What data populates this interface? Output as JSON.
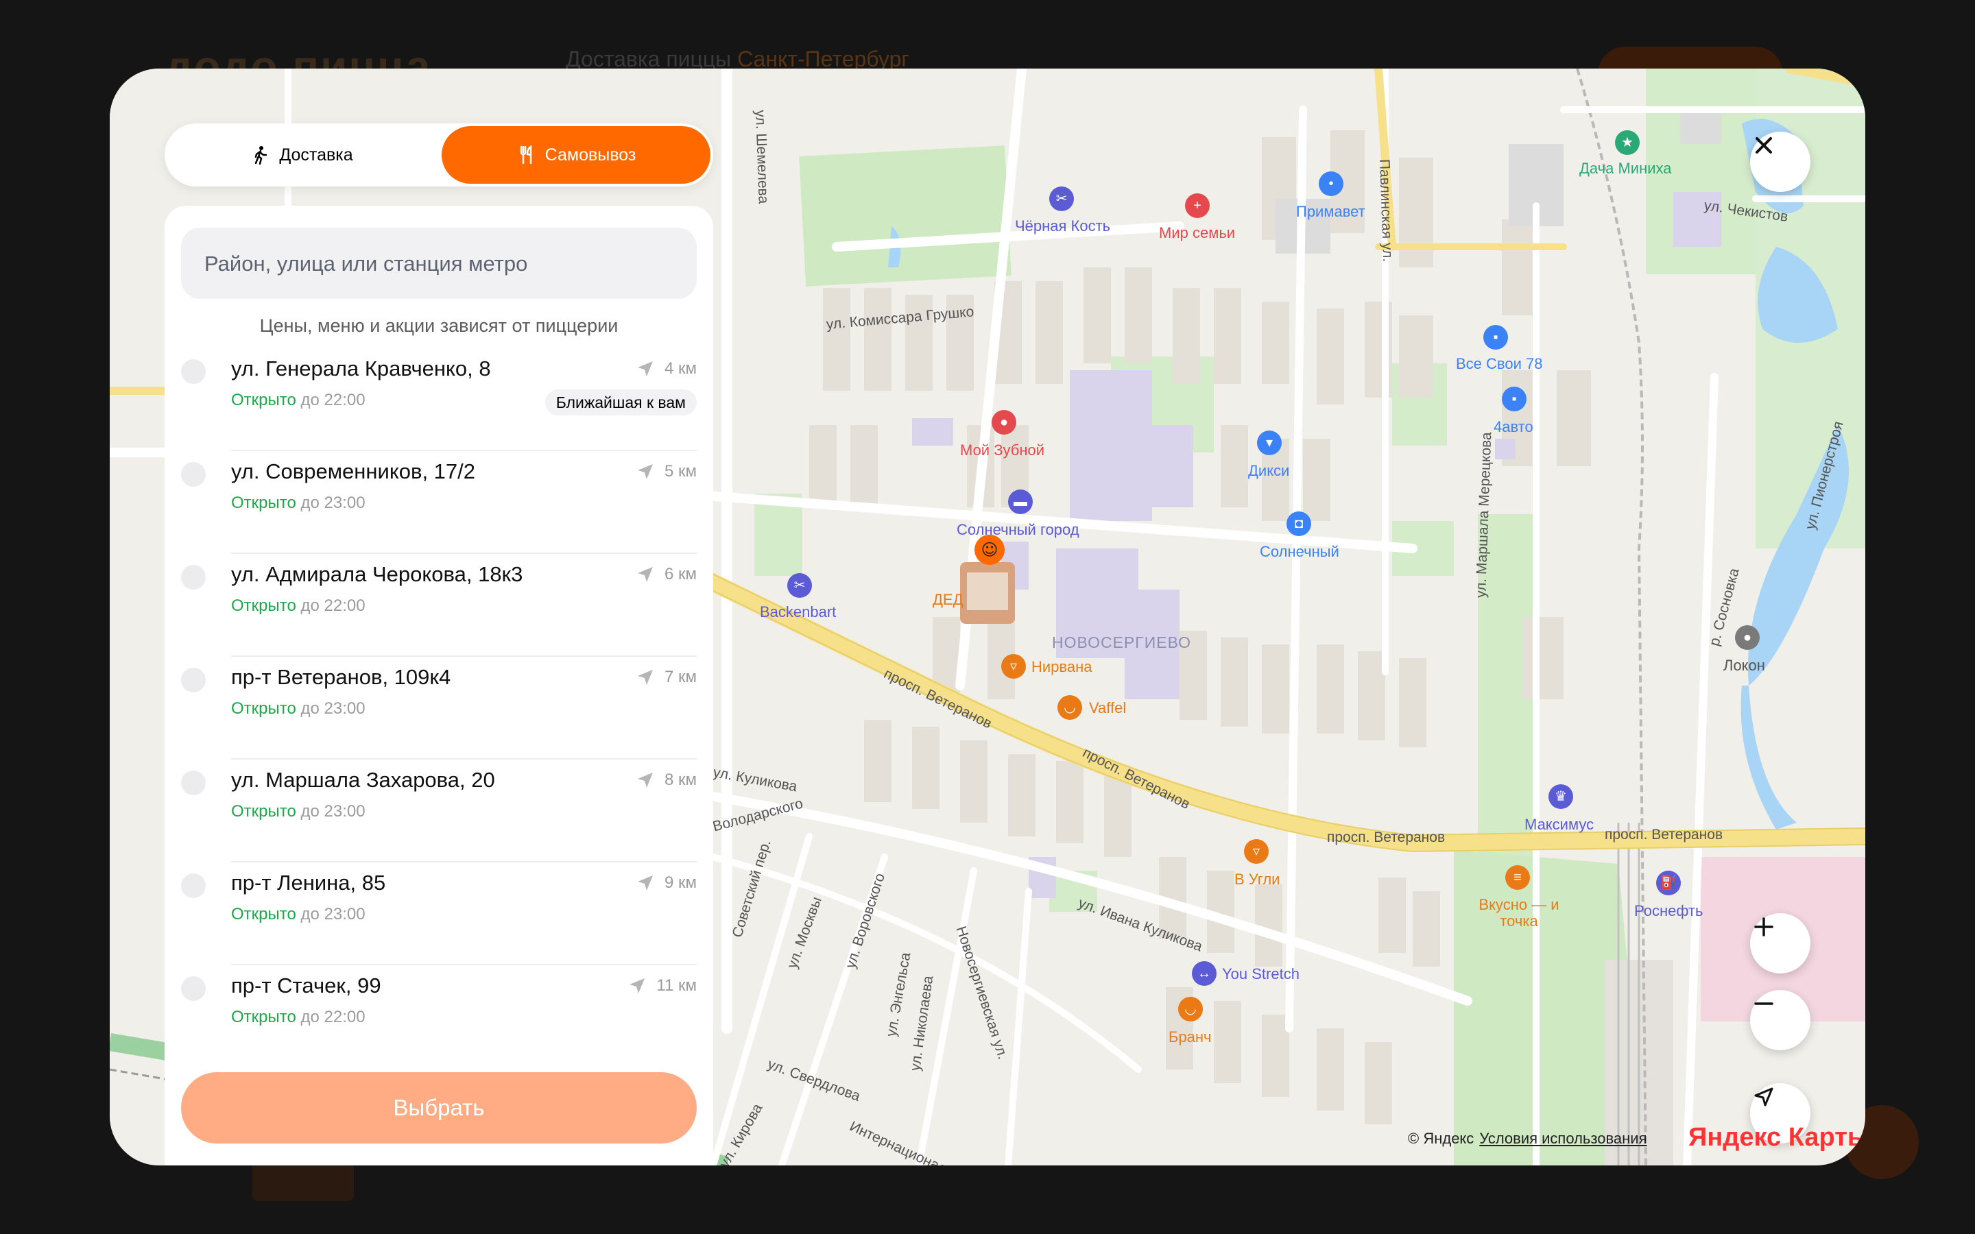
{
  "background": {
    "logo": "додо пицца",
    "delivery_title": "Доставка пиццы",
    "city": "Санкт-Петербург"
  },
  "toggle": {
    "delivery_label": "Доставка",
    "pickup_label": "Самовывоз",
    "active": "pickup"
  },
  "search": {
    "placeholder": "Район, улица или станция метро",
    "value": ""
  },
  "hint": "Цены, меню и акции зависят от пиццерии",
  "pizzerias": [
    {
      "address": "ул. Генерала Кравченко, 8",
      "status": "Открыто",
      "hours": "до 22:00",
      "distance": "4 км",
      "badge": "Ближайшая к вам"
    },
    {
      "address": "ул. Современников, 17/2",
      "status": "Открыто",
      "hours": "до 23:00",
      "distance": "5 км"
    },
    {
      "address": "ул. Адмирала Черокова, 18к3",
      "status": "Открыто",
      "hours": "до 22:00",
      "distance": "6 км"
    },
    {
      "address": "пр-т Ветеранов, 109к4",
      "status": "Открыто",
      "hours": "до 23:00",
      "distance": "7 км"
    },
    {
      "address": "ул. Маршала Захарова, 20",
      "status": "Открыто",
      "hours": "до 23:00",
      "distance": "8 км"
    },
    {
      "address": "пр-т Ленина, 85",
      "status": "Открыто",
      "hours": "до 23:00",
      "distance": "9 км"
    },
    {
      "address": "пр-т Стачек, 99",
      "status": "Открыто",
      "hours": "до 22:00",
      "distance": "11 км"
    }
  ],
  "choose_button": "Выбрать",
  "map": {
    "pois": [
      {
        "name": "Чёрная Кость",
        "color": "#5b5bd6",
        "icon": "scissors-icon"
      },
      {
        "name": "Мир семьи",
        "color": "#e5484d",
        "icon": "medical-icon"
      },
      {
        "name": "Примавет",
        "color": "#3b82f6",
        "icon": "paw-icon"
      },
      {
        "name": "Дача Миниха",
        "color": "#2aa876",
        "icon": "star-icon"
      },
      {
        "name": "Все Свои 78",
        "color": "#3b82f6",
        "icon": "car-icon"
      },
      {
        "name": "4авто",
        "color": "#3b82f6",
        "icon": "car-icon"
      },
      {
        "name": "Мой Зубной",
        "color": "#e5484d",
        "icon": "tooth-icon"
      },
      {
        "name": "Дикси",
        "color": "#3b82f6",
        "icon": "basket-icon"
      },
      {
        "name": "Солнечный город",
        "color": "#5b5bd6",
        "icon": "briefcase-icon"
      },
      {
        "name": "Солнечный",
        "color": "#3b82f6",
        "icon": "shopping-bag-icon"
      },
      {
        "name": "Backenbart",
        "color": "#5b5bd6",
        "icon": "scissors-icon"
      },
      {
        "name": "ДЕД",
        "color": "#ea7a16",
        "icon": "food-icon"
      },
      {
        "name": "Нирвана",
        "color": "#ea7a16",
        "icon": "food-icon"
      },
      {
        "name": "Vaffel",
        "color": "#ea7a16",
        "icon": "coffee-icon"
      },
      {
        "name": "Локон",
        "color": "#7a7a7a",
        "icon": "beauty-icon"
      },
      {
        "name": "Максимус",
        "color": "#5b5bd6",
        "icon": "trophy-icon"
      },
      {
        "name": "В Угли",
        "color": "#ea7a16",
        "icon": "food-icon"
      },
      {
        "name": "Вкусно — и точка",
        "color": "#ea7a16",
        "icon": "burger-icon"
      },
      {
        "name": "Роснефть",
        "color": "#5b5bd6",
        "icon": "fuel-icon"
      },
      {
        "name": "You Stretch",
        "color": "#5b5bd6",
        "icon": "fitness-icon"
      },
      {
        "name": "Бранч",
        "color": "#ea7a16",
        "icon": "coffee-icon"
      }
    ],
    "district": "НОВОСЕРГИЕВО",
    "streets": [
      "ул. Комиссара Грушко",
      "просп. Ветеранов",
      "ул. Ивана Куликова",
      "Павлинская ул.",
      "ул. Маршала Мерецкова",
      "ул. Пионерстроя",
      "ул. Чекистов",
      "Советский пер.",
      "ул. Воровского",
      "ул. Энгельса",
      "ул. Николаева",
      "Новосергиевская ул.",
      "ул. Свердлова",
      "ул. Кирова",
      "Интернациональная",
      "Володарского",
      "ул. Москвы",
      "ул. Куликова",
      "р. Сосновка",
      "ул. Шемелева"
    ],
    "copyright": "© Яндекс",
    "terms_link": "Условия использования",
    "provider_logo": "Яндекс Карты"
  },
  "colors": {
    "accent": "#ff6900",
    "open_status": "#1ea64a",
    "button_disabled": "#ffac84"
  }
}
